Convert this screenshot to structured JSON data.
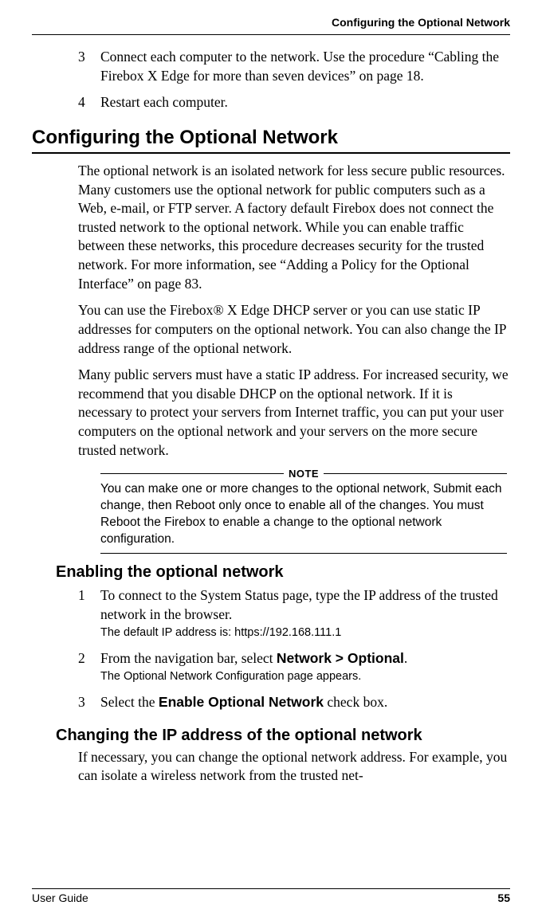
{
  "header": {
    "running_head": "Configuring the Optional Network"
  },
  "step3": {
    "num": "3",
    "text": "Connect each computer to the network. Use the procedure “Cabling the Firebox X Edge for more than seven devices” on page 18."
  },
  "step4": {
    "num": "4",
    "text": "Restart each computer."
  },
  "section_title": "Configuring the Optional Network",
  "para1": "The optional network is an isolated network for less secure public resources. Many customers use the optional network for public com­puters such as a Web, e-mail, or FTP server. A factory default Fire­box does not connect the trusted network to the optional network. While you can enable traffic between these networks, this procedure decreases security for the trusted network. For more information, see “Adding a Policy for the Optional Interface” on page 83.",
  "para2": "You can use the Firebox® X Edge DHCP server or you can use static IP addresses for computers on the optional network. You can also change the IP address range of the optional network.",
  "para3": "Many public servers must have a static IP address. For increased security, we recommend that you disable DHCP on the optional net­work. If it is necessary to protect your servers from Internet traffic, you can put your user computers on the optional network and your servers on the more secure trusted network.",
  "note": {
    "label": "NOTE",
    "body": "You can make one or more changes to the optional network, Submit each change, then Reboot only once to enable all of the changes. You must Reboot the Firebox to enable a change to the optional network configuration."
  },
  "subsection1": "Enabling the optional network",
  "s1_step1": {
    "num": "1",
    "text": "To connect to the System Status page, type the IP address of the trusted network in the browser.",
    "sub": "The default IP address is: https://192.168.111.1"
  },
  "s1_step2": {
    "num": "2",
    "text_a": "From the navigation bar, select ",
    "text_b": "Network > Optional",
    "text_c": ".",
    "sub": "The Optional Network Configuration page appears."
  },
  "s1_step3": {
    "num": "3",
    "text_a": "Select the ",
    "text_b": "Enable Optional Network",
    "text_c": " check box."
  },
  "subsection2": "Changing the IP address of the optional network",
  "para4": "If necessary, you can change the optional network address. For example, you can isolate a wireless network from the trusted net-",
  "footer": {
    "left": "User Guide",
    "right": "55"
  }
}
